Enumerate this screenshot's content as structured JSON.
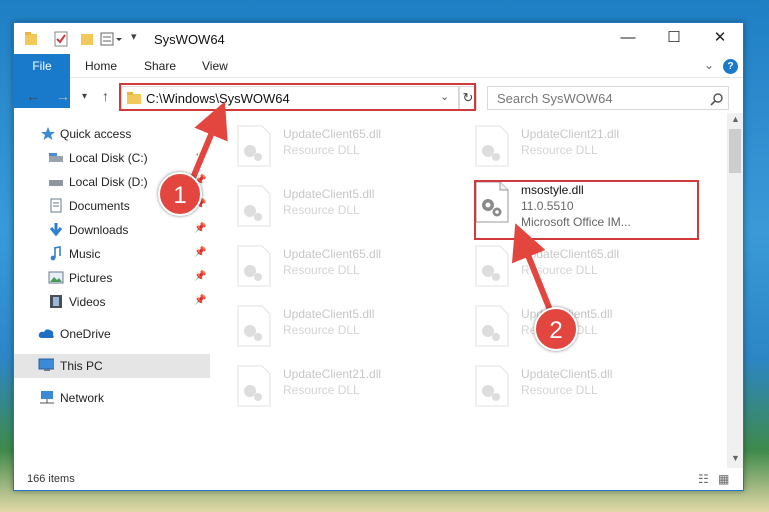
{
  "window": {
    "title": "SysWOW64",
    "controls": {
      "minimize": "—",
      "maximize": "☐",
      "close": "✕"
    }
  },
  "ribbon": {
    "tabs": [
      {
        "label": "File"
      },
      {
        "label": "Home"
      },
      {
        "label": "Share"
      },
      {
        "label": "View"
      }
    ]
  },
  "address_bar": {
    "path": "C:\\Windows\\SysWOW64"
  },
  "search": {
    "placeholder": "Search SysWOW64"
  },
  "sidebar": {
    "items": [
      {
        "label": "Quick access",
        "icon": "star-icon"
      },
      {
        "label": "Local Disk (C:)",
        "icon": "drive-icon"
      },
      {
        "label": "Local Disk (D:)",
        "icon": "drive-icon"
      },
      {
        "label": "Documents",
        "icon": "documents-icon"
      },
      {
        "label": "Downloads",
        "icon": "download-arrow-icon"
      },
      {
        "label": "Music",
        "icon": "music-note-icon"
      },
      {
        "label": "Pictures",
        "icon": "pictures-icon"
      },
      {
        "label": "Videos",
        "icon": "film-icon"
      },
      {
        "label": "OneDrive",
        "icon": "cloud-icon"
      },
      {
        "label": "This PC",
        "icon": "computer-icon"
      },
      {
        "label": "Network",
        "icon": "network-icon"
      }
    ]
  },
  "files": [
    {
      "name": "UpdateClient65.dll",
      "type": "Resource DLL"
    },
    {
      "name": "UpdateClient21.dll",
      "type": "Resource DLL"
    },
    {
      "name": "UpdateClient5.dll",
      "type": "Resource DLL"
    },
    {
      "name": "msostyle.dll",
      "version": "11.0.5510",
      "type": "Microsoft Office IM..."
    },
    {
      "name": "UpdateClient65.dll",
      "type": "Resource DLL"
    },
    {
      "name": "UpdateClient65.dll",
      "type": "Resource DLL"
    },
    {
      "name": "UpdateClient5.dll",
      "type": "Resource DLL"
    },
    {
      "name": "UpdateClient5.dll",
      "type": "Resource DLL"
    },
    {
      "name": "UpdateClient21.dll",
      "type": "Resource DLL"
    },
    {
      "name": "UpdateClient5.dll",
      "type": "Resource DLL"
    }
  ],
  "annotations": {
    "step1": "1",
    "step2": "2"
  },
  "status": {
    "item_count": "166 items"
  },
  "colors": {
    "accent": "#1979ca",
    "highlight": "#d03a3a",
    "badge": "#e2463f"
  }
}
